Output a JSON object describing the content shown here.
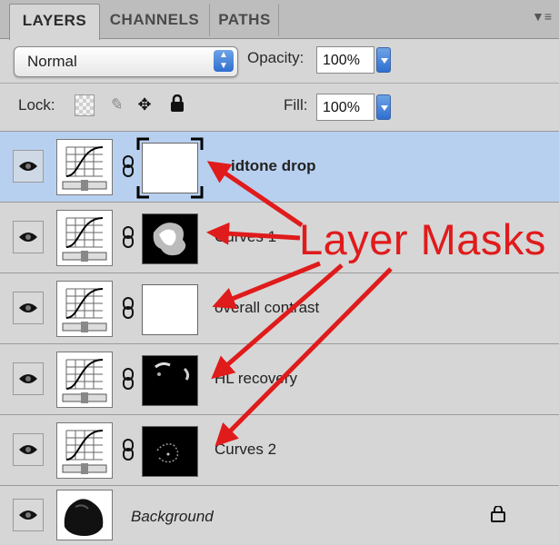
{
  "tabs": [
    {
      "label": "LAYERS",
      "active": true
    },
    {
      "label": "CHANNELS",
      "active": false
    },
    {
      "label": "PATHS",
      "active": false
    }
  ],
  "panel_menu_icon": "panel-options-icon",
  "blend_mode": {
    "value": "Normal"
  },
  "opacity": {
    "label": "Opacity:",
    "value": "100%"
  },
  "lock": {
    "label": "Lock:",
    "icons": [
      "lock-transparent-pixels-icon",
      "lock-image-pixels-icon",
      "lock-position-icon",
      "lock-all-icon"
    ]
  },
  "fill": {
    "label": "Fill:",
    "value": "100%"
  },
  "layers": [
    {
      "name": "Midtone drop",
      "visible_name": "idtone drop",
      "type": "adjustment-curves",
      "mask": "white",
      "selected": true
    },
    {
      "name": "Curves 1",
      "type": "adjustment-curves",
      "mask": "black-partial",
      "selected": false
    },
    {
      "name": "overall contrast",
      "type": "adjustment-curves",
      "mask": "white",
      "selected": false
    },
    {
      "name": "HL recovery",
      "type": "adjustment-curves",
      "mask": "black-partial",
      "selected": false
    },
    {
      "name": "Curves 2",
      "type": "adjustment-curves",
      "mask": "black-partial",
      "selected": false
    },
    {
      "name": "Background",
      "type": "image",
      "locked": true,
      "selected": false
    }
  ],
  "annotation": {
    "text": "Layer Masks",
    "color": "#e01b1b"
  }
}
